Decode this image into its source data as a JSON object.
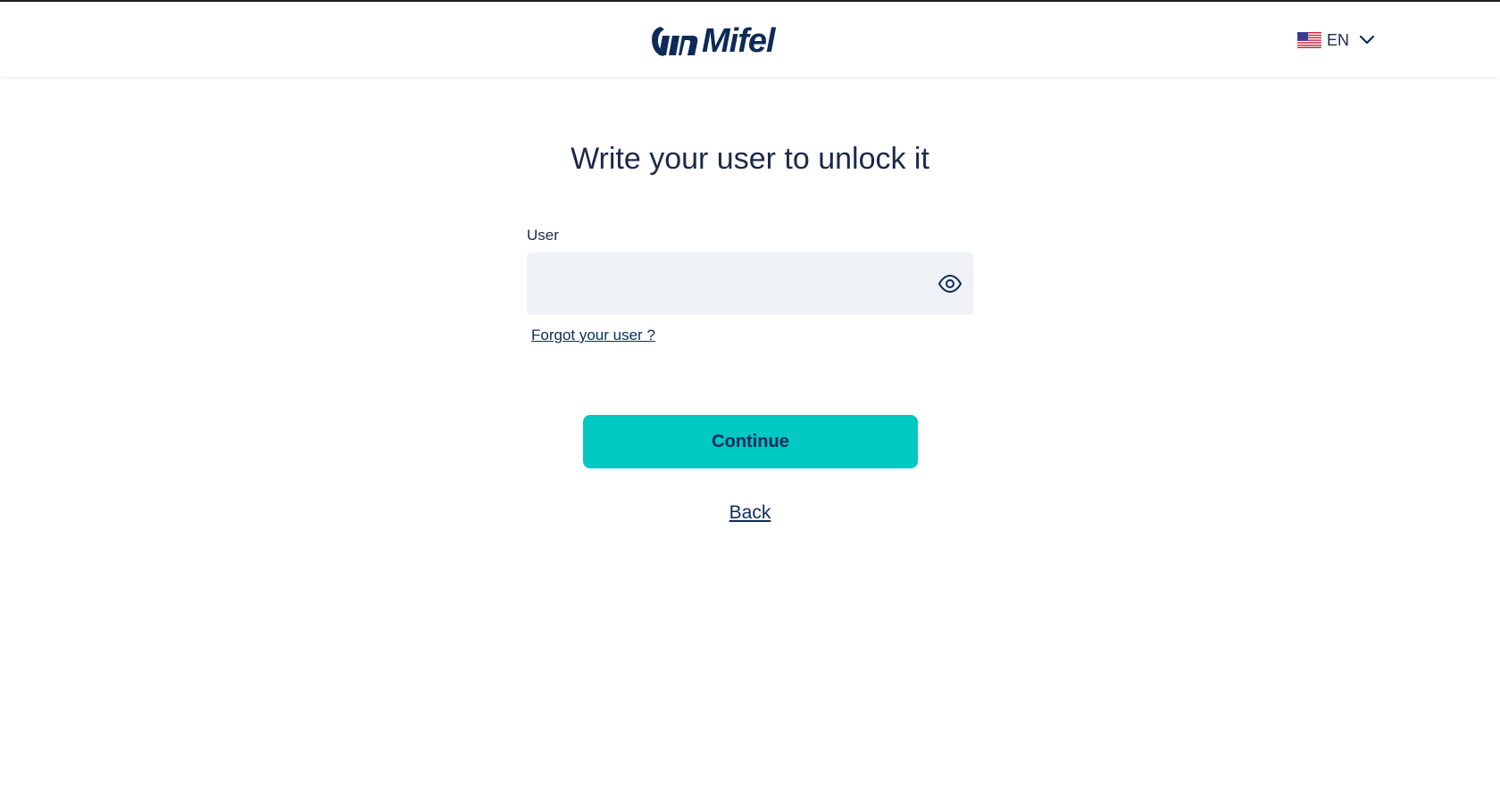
{
  "header": {
    "brand": "Mifel",
    "language": {
      "label": "EN",
      "flag_icon": "us-flag-icon",
      "chevron_icon": "chevron-down-icon"
    }
  },
  "form": {
    "title": "Write your user to unlock it",
    "user_label": "User",
    "user_value": "",
    "toggle_icon": "eye-icon",
    "forgot_link": "Forgot your user ?",
    "continue_label": "Continue",
    "back_link": "Back"
  },
  "colors": {
    "brand_navy": "#0d2b59",
    "accent_teal": "#00c8c2",
    "input_bg": "#eef2f6"
  }
}
